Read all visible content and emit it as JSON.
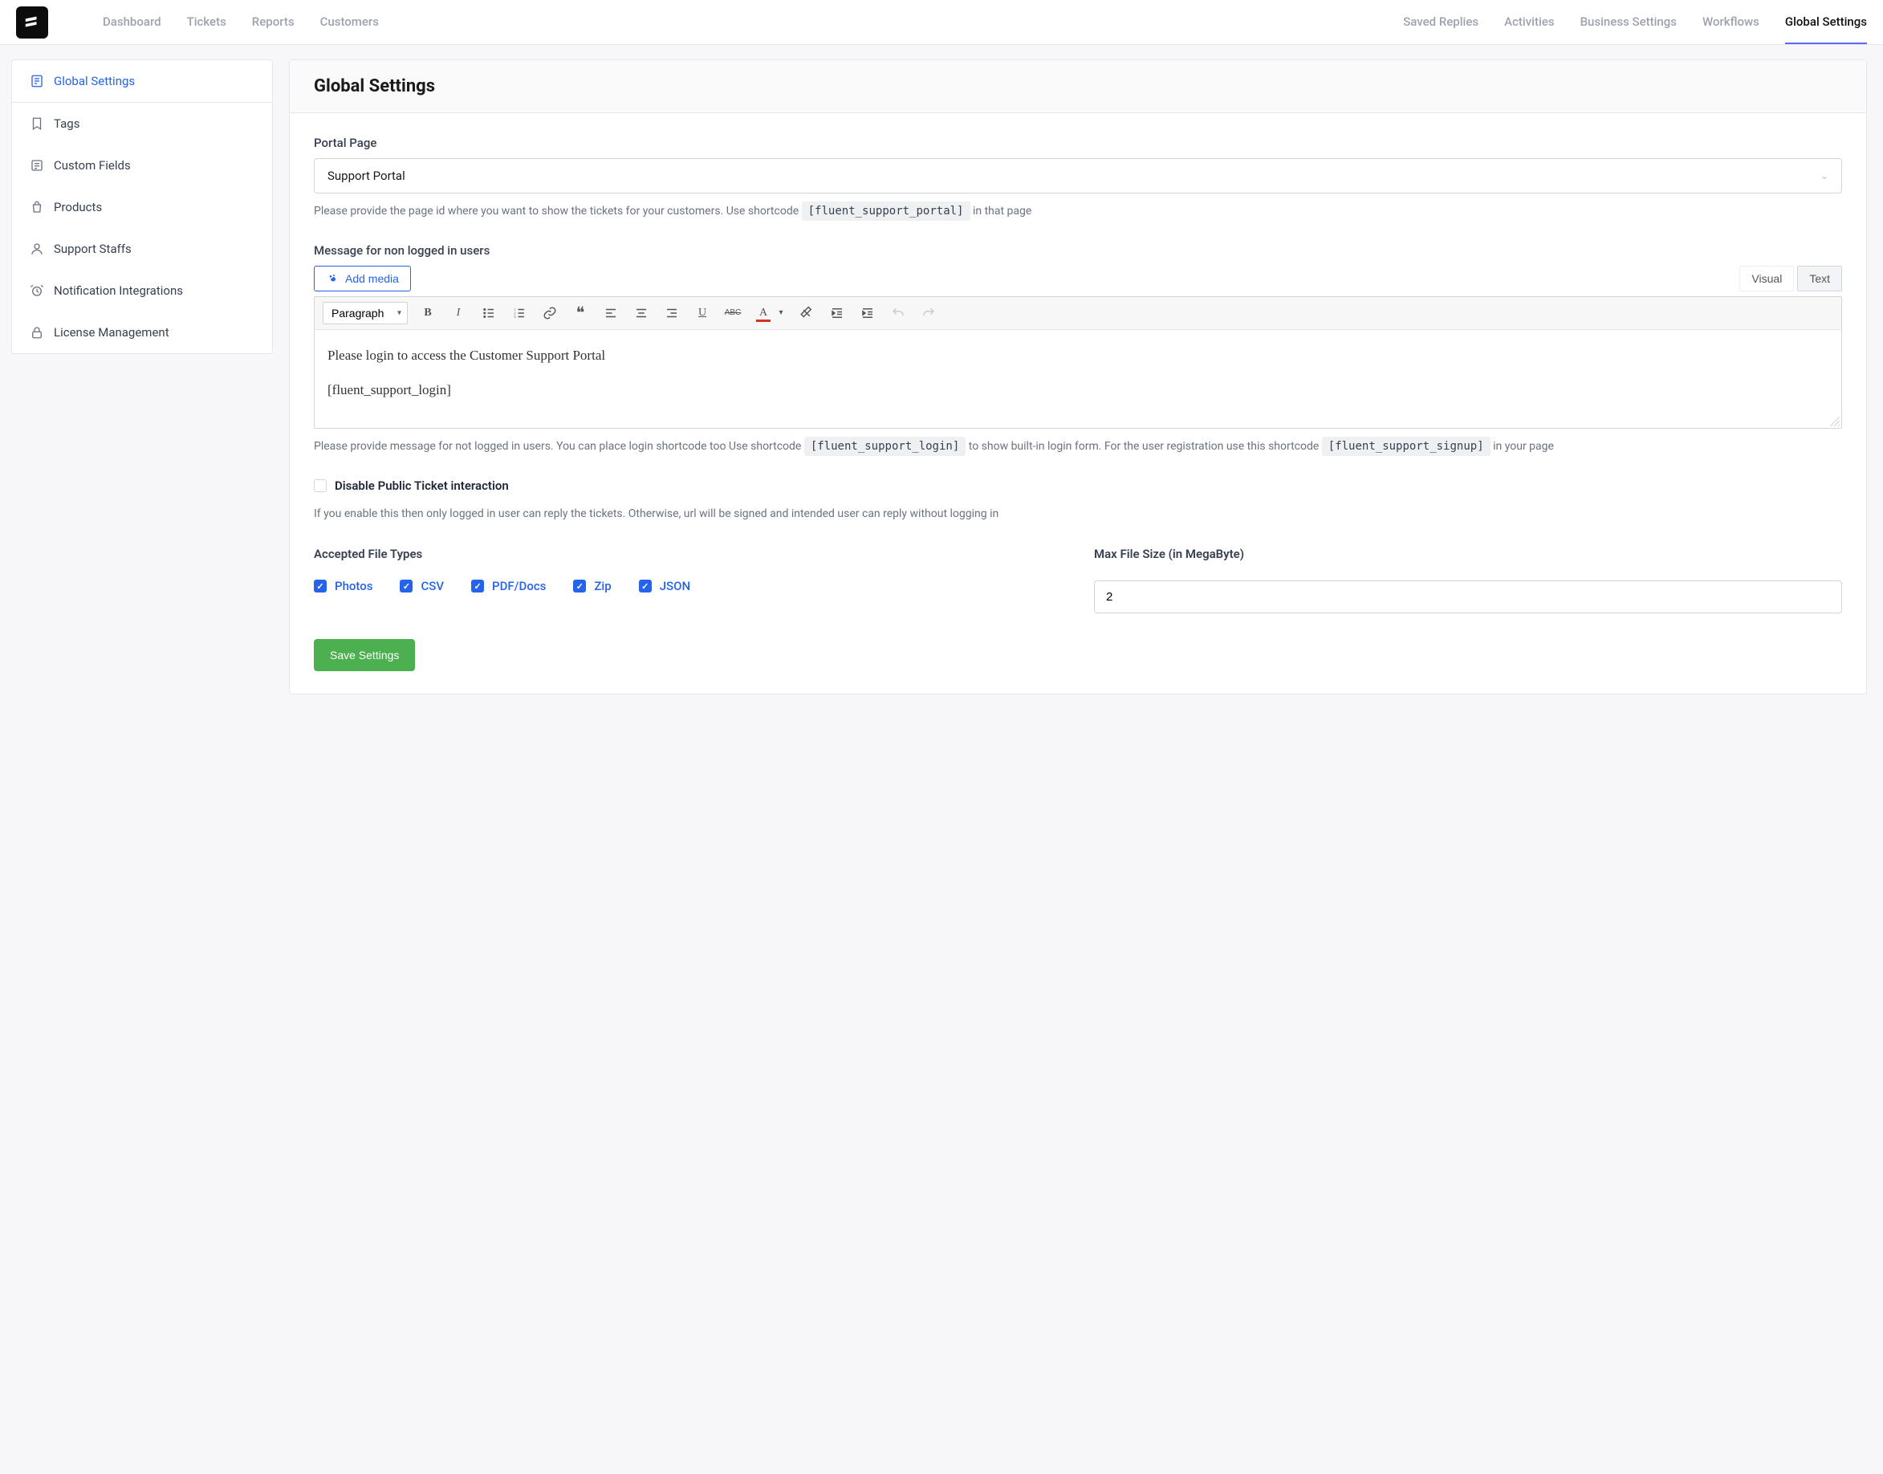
{
  "topnav": {
    "items": [
      {
        "label": "Dashboard"
      },
      {
        "label": "Tickets"
      },
      {
        "label": "Reports"
      },
      {
        "label": "Customers"
      },
      {
        "label": "Saved Replies"
      },
      {
        "label": "Activities"
      },
      {
        "label": "Business Settings"
      },
      {
        "label": "Workflows"
      },
      {
        "label": "Global Settings"
      }
    ]
  },
  "sidebar": {
    "items": [
      {
        "label": "Global Settings"
      },
      {
        "label": "Tags"
      },
      {
        "label": "Custom Fields"
      },
      {
        "label": "Products"
      },
      {
        "label": "Support Staffs"
      },
      {
        "label": "Notification Integrations"
      },
      {
        "label": "License Management"
      }
    ]
  },
  "page": {
    "title": "Global Settings"
  },
  "portal": {
    "label": "Portal Page",
    "selected": "Support Portal",
    "help_prefix": "Please provide the page id where you want to show the tickets for your customers. Use shortcode ",
    "shortcode": "[fluent_support_portal]",
    "help_suffix": " in that page"
  },
  "message": {
    "label": "Message for non logged in users",
    "add_media": "Add media",
    "tab_visual": "Visual",
    "tab_text": "Text",
    "format": "Paragraph",
    "content_line1": "Please login to access the Customer Support Portal",
    "content_line2": "[fluent_support_login]",
    "help_prefix": "Please provide message for not logged in users. You can place login shortcode too Use shortcode ",
    "shortcode1": "[fluent_support_login]",
    "help_mid": " to show built-in login form. For the user registration use this shortcode ",
    "shortcode2": "[fluent_support_signup]",
    "help_suffix": " in your page"
  },
  "disable_public": {
    "label": "Disable Public Ticket interaction",
    "help": "If you enable this then only logged in user can reply the tickets. Otherwise, url will be signed and intended user can reply without logging in"
  },
  "file_types": {
    "label": "Accepted File Types",
    "options": [
      {
        "label": "Photos"
      },
      {
        "label": "CSV"
      },
      {
        "label": "PDF/Docs"
      },
      {
        "label": "Zip"
      },
      {
        "label": "JSON"
      }
    ]
  },
  "max_size": {
    "label": "Max File Size (in MegaByte)",
    "value": "2"
  },
  "save": {
    "label": "Save Settings"
  }
}
